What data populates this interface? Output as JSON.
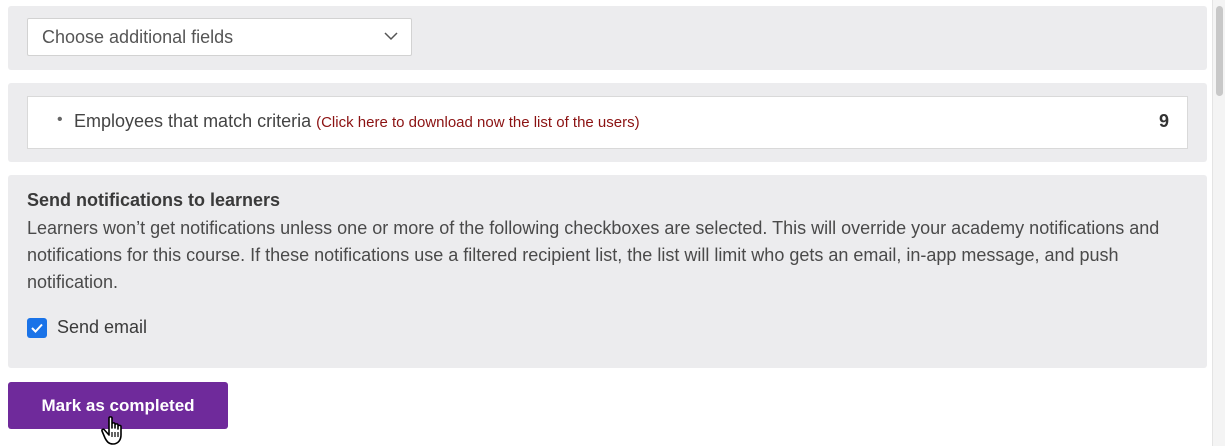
{
  "fields_select": {
    "placeholder": "Choose additional fields",
    "icon": "chevron-down-icon"
  },
  "match": {
    "label": "Employees that match criteria",
    "link_text": "(Click here to download now the list of the users)",
    "count": "9",
    "link_color": "#8b1212"
  },
  "notifications": {
    "title": "Send notifications to learners",
    "description": "Learners won’t get notifications unless one or more of the following checkboxes are selected. This will override your academy notifications and notifications for this course. If these notifications use a filtered recipient list, the list will limit who gets an email, in-app message, and push notification.",
    "send_email_label": "Send email",
    "send_email_checked": true,
    "checkbox_color": "#1a73e8"
  },
  "actions": {
    "mark_completed_label": "Mark as completed",
    "button_color": "#6f2a9b"
  },
  "cursor": {
    "icon": "hand-pointer-icon"
  },
  "colors": {
    "panel_background": "#ececee"
  }
}
